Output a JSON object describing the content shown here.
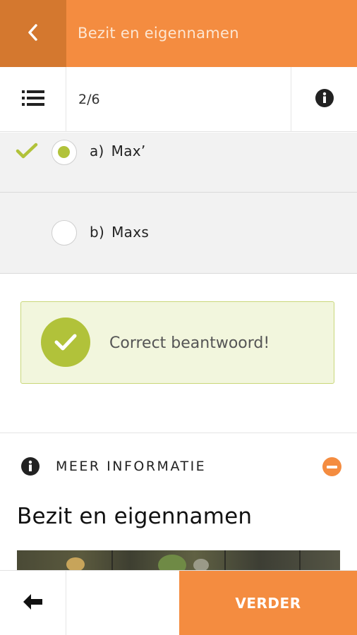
{
  "header": {
    "title": "Bezit en eigennamen",
    "back_icon": "chevron-left-icon"
  },
  "toolbar": {
    "list_icon": "list-icon",
    "progress": "2/6",
    "info_icon": "info-icon"
  },
  "options": [
    {
      "letter": "a)",
      "text": "Max’",
      "selected": true,
      "correct": true
    },
    {
      "letter": "b)",
      "text": "Maxs",
      "selected": false,
      "correct": false
    }
  ],
  "feedback": {
    "message": "Correct beantwoord!",
    "icon": "check-icon"
  },
  "more_info": {
    "label": "MEER INFORMATIE",
    "icon": "info-icon",
    "toggle_icon": "minus-circle-icon",
    "title": "Bezit en eigennamen"
  },
  "footer": {
    "prev_icon": "arrow-left-icon",
    "next_label": "VERDER"
  },
  "colors": {
    "accent": "#f48c40",
    "accent_dark": "#d4782f",
    "correct": "#b1c23a",
    "feedback_bg": "#f2f6dd"
  }
}
